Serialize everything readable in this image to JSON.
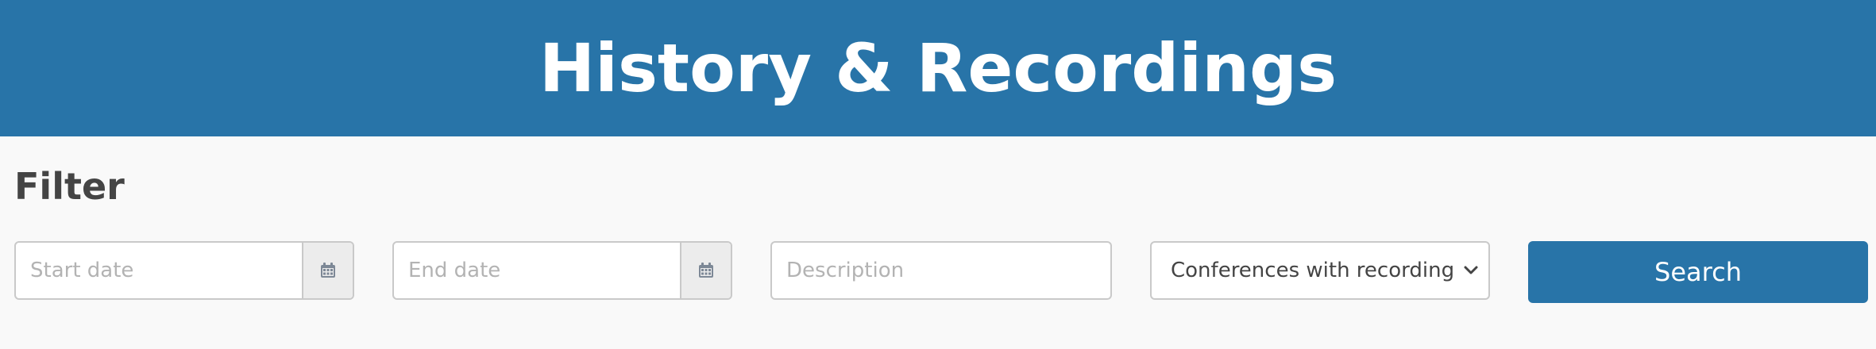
{
  "header": {
    "title": "History & Recordings",
    "background_color": "#2874a8"
  },
  "filter": {
    "title": "Filter",
    "start_date": {
      "placeholder": "Start date",
      "value": "",
      "icon": "calendar-icon"
    },
    "end_date": {
      "placeholder": "End date",
      "value": "",
      "icon": "calendar-icon"
    },
    "description": {
      "placeholder": "Description",
      "value": ""
    },
    "recordings_select": {
      "selected": "Conferences with recordings only",
      "icon": "chevron-down-icon"
    },
    "search_button": {
      "label": "Search",
      "color": "#2874a8"
    }
  }
}
